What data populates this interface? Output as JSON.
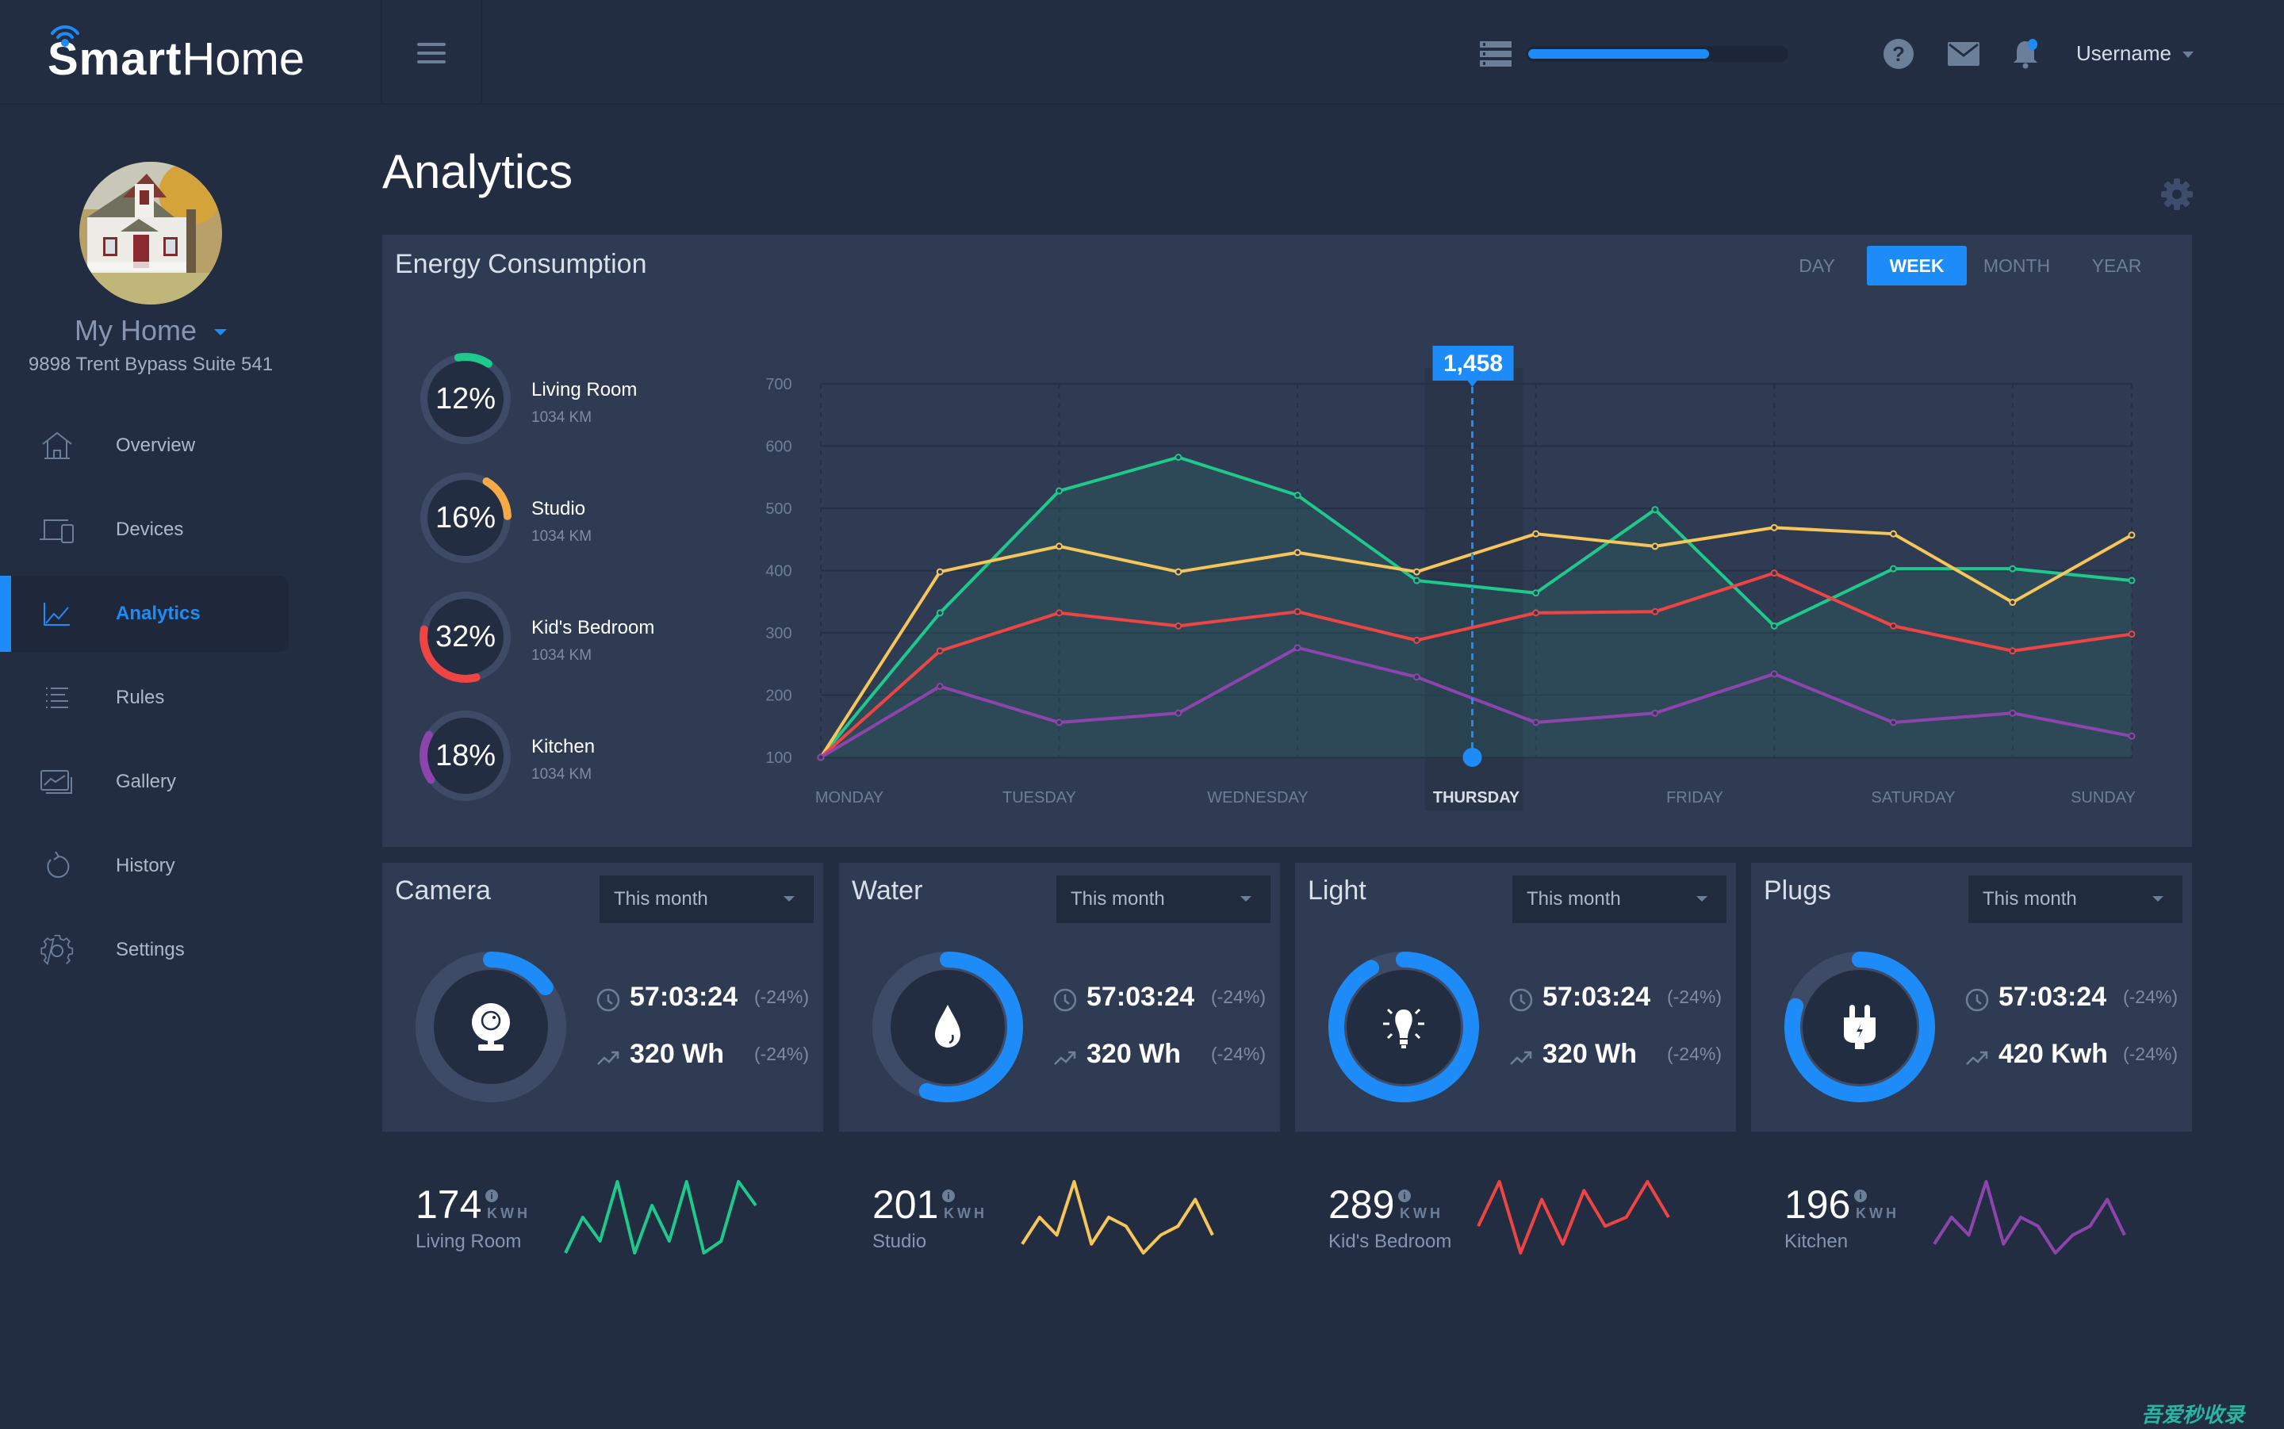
{
  "header": {
    "logo_bold": "Smart",
    "logo_light": "Home",
    "storage_progress": 0.7,
    "username": "Username"
  },
  "sidebar": {
    "home_name": "My Home",
    "home_address": "9898 Trent Bypass Suite 541",
    "items": [
      {
        "label": "Overview",
        "icon": "home-icon",
        "active": false
      },
      {
        "label": "Devices",
        "icon": "devices-icon",
        "active": false
      },
      {
        "label": "Analytics",
        "icon": "analytics-icon",
        "active": true
      },
      {
        "label": "Rules",
        "icon": "rules-icon",
        "active": false
      },
      {
        "label": "Gallery",
        "icon": "gallery-icon",
        "active": false
      },
      {
        "label": "History",
        "icon": "history-icon",
        "active": false
      },
      {
        "label": "Settings",
        "icon": "settings-icon",
        "active": false
      }
    ]
  },
  "page": {
    "title": "Analytics"
  },
  "energy": {
    "title": "Energy Consumption",
    "tabs": [
      "DAY",
      "WEEK",
      "MONTH",
      "YEAR"
    ],
    "active_tab": "WEEK",
    "rooms": [
      {
        "name": "Living Room",
        "sub": "1034 KM",
        "percent": 12,
        "pct_label": "12%",
        "color": "#1ec98c"
      },
      {
        "name": "Studio",
        "sub": "1034 KM",
        "percent": 16,
        "pct_label": "16%",
        "color": "#f7a945"
      },
      {
        "name": "Kid's Bedroom",
        "sub": "1034 KM",
        "percent": 32,
        "pct_label": "32%",
        "color": "#ef4444"
      },
      {
        "name": "Kitchen",
        "sub": "1034 KM",
        "percent": 18,
        "pct_label": "18%",
        "color": "#8e44ad"
      }
    ]
  },
  "chart_data": {
    "type": "line",
    "title": "Energy Consumption",
    "x_labels": [
      "MONDAY",
      "TUESDAY",
      "WEDNESDAY",
      "THURSDAY",
      "FRIDAY",
      "SATURDAY",
      "SUNDAY"
    ],
    "highlighted_label": "THURSDAY",
    "tooltip": "1,458",
    "y_ticks": [
      100,
      200,
      300,
      400,
      500,
      600,
      700
    ],
    "ylim": [
      100,
      700
    ],
    "grid": true,
    "point_count": 12,
    "series": [
      {
        "name": "Living Room",
        "color": "#1ec98c",
        "filled": true,
        "values": [
          100,
          332,
          528,
          582,
          521,
          384,
          364,
          498,
          311,
          403,
          403,
          384
        ]
      },
      {
        "name": "Studio",
        "color": "#f7c65a",
        "values": [
          100,
          398,
          439,
          398,
          429,
          398,
          459,
          439,
          469,
          459,
          349,
          457
        ]
      },
      {
        "name": "Kid's Bedroom",
        "color": "#ef4444",
        "values": [
          100,
          271,
          332,
          311,
          334,
          288,
          332,
          334,
          396,
          311,
          271,
          298
        ]
      },
      {
        "name": "Kitchen",
        "color": "#8e44ad",
        "values": [
          100,
          214,
          156,
          171,
          276,
          229,
          156,
          171,
          234,
          156,
          171,
          134
        ]
      }
    ]
  },
  "devices": [
    {
      "title": "Camera",
      "period": "This month",
      "time": "57:03:24",
      "time_delta": "(-24%)",
      "energy": "320 Wh",
      "energy_delta": "(-24%)",
      "progress": 0.15,
      "icon": "webcam-icon"
    },
    {
      "title": "Water",
      "period": "This month",
      "time": "57:03:24",
      "time_delta": "(-24%)",
      "energy": "320 Wh",
      "energy_delta": "(-24%)",
      "progress": 0.55,
      "icon": "water-drop-icon"
    },
    {
      "title": "Light",
      "period": "This month",
      "time": "57:03:24",
      "time_delta": "(-24%)",
      "energy": "320 Wh",
      "energy_delta": "(-24%)",
      "progress": 0.92,
      "icon": "light-bulb-icon"
    },
    {
      "title": "Plugs",
      "period": "This month",
      "time": "57:03:24",
      "time_delta": "(-24%)",
      "energy": "420 Kwh",
      "energy_delta": "(-24%)",
      "progress": 0.8,
      "icon": "plug-icon"
    }
  ],
  "sparklines": [
    {
      "value": "174",
      "unit": "KWH",
      "label": "Living Room",
      "color": "#1ec98c",
      "points": [
        2,
        5,
        3,
        8,
        2,
        6,
        3,
        8,
        2,
        3,
        8,
        6
      ]
    },
    {
      "value": "201",
      "unit": "KWH",
      "label": "Studio",
      "color": "#f7c65a",
      "points": [
        3,
        6,
        4,
        10,
        3,
        6,
        5,
        2,
        4,
        5,
        8,
        4
      ]
    },
    {
      "value": "289",
      "unit": "KWH",
      "label": "Kid's Bedroom",
      "color": "#ef4444",
      "points": [
        4,
        9,
        1,
        7,
        2,
        8,
        4,
        5,
        9,
        5
      ]
    },
    {
      "value": "196",
      "unit": "KWH",
      "label": "Kitchen",
      "color": "#8e44ad",
      "points": [
        3,
        6,
        4,
        10,
        3,
        6,
        5,
        2,
        4,
        5,
        8,
        4
      ]
    }
  ],
  "watermark": "吾爱秒收录"
}
